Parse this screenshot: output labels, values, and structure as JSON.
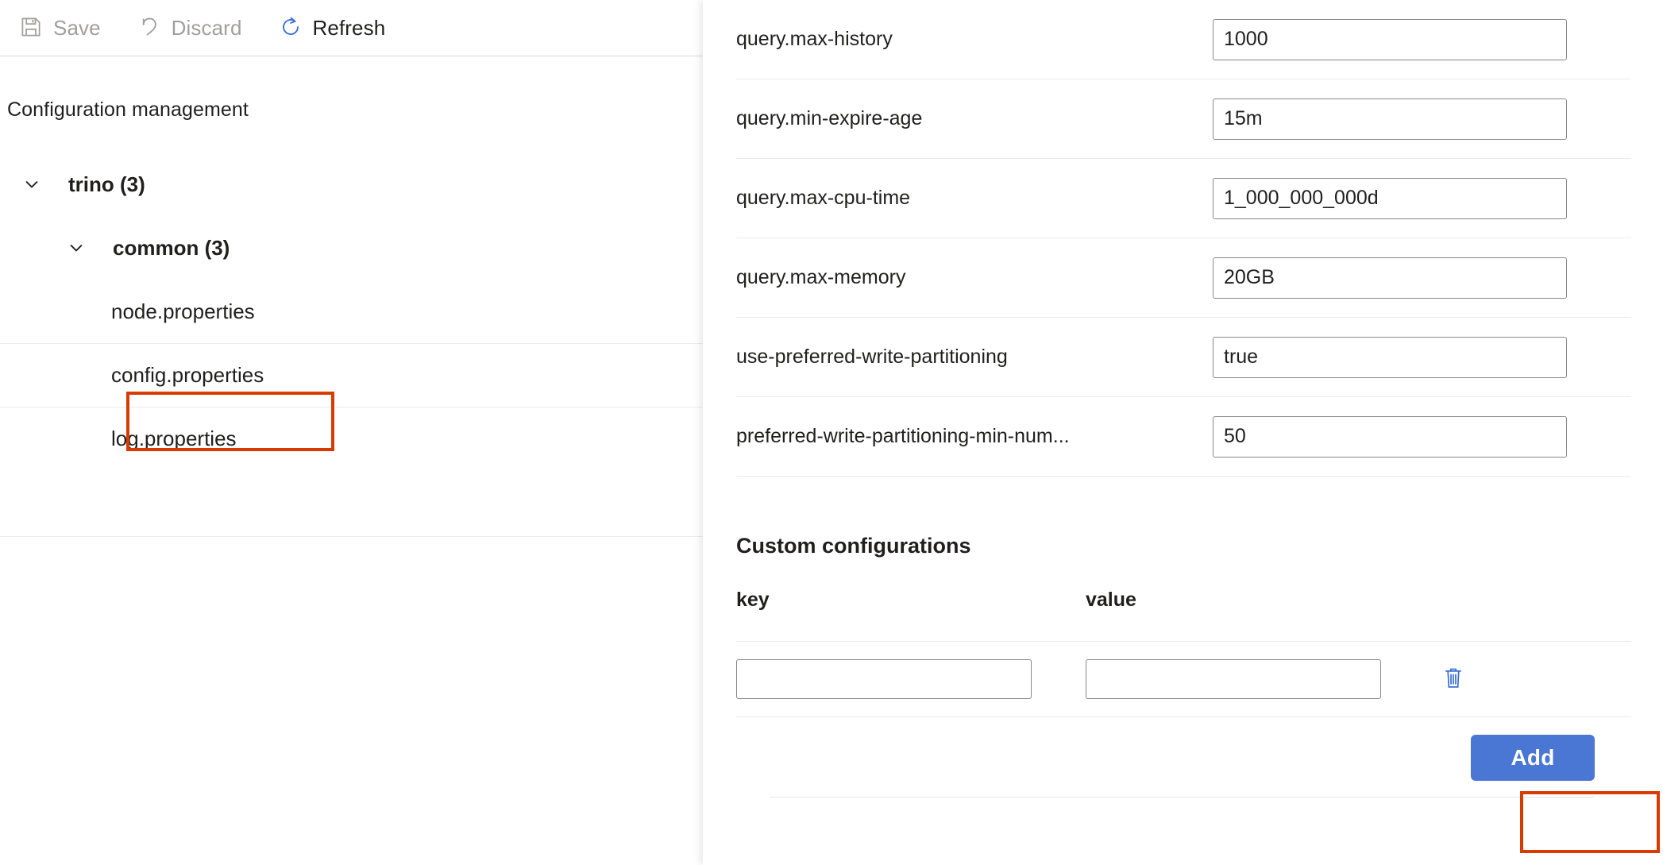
{
  "toolbar": {
    "items": [
      {
        "label": "Save",
        "icon": "save-icon",
        "state": "disabled"
      },
      {
        "label": "Discard",
        "icon": "undo-icon",
        "state": "disabled"
      },
      {
        "label": "Refresh",
        "icon": "refresh-icon",
        "state": "enabled"
      }
    ]
  },
  "left_pane": {
    "title": "Configuration management",
    "tree": [
      {
        "label": "trino (3)",
        "level": 0,
        "expanded": true,
        "bold": true,
        "has_chevron": true,
        "divider_above": false,
        "selected": false
      },
      {
        "label": "common (3)",
        "level": 1,
        "expanded": true,
        "bold": true,
        "has_chevron": true,
        "divider_above": false,
        "selected": false
      },
      {
        "label": "node.properties",
        "level": 2,
        "expanded": false,
        "bold": false,
        "has_chevron": false,
        "divider_above": false,
        "selected": false
      },
      {
        "label": "config.properties",
        "level": 2,
        "expanded": false,
        "bold": false,
        "has_chevron": false,
        "divider_above": true,
        "selected": true
      },
      {
        "label": "log.properties",
        "level": 2,
        "expanded": false,
        "bold": false,
        "has_chevron": false,
        "divider_above": true,
        "selected": false
      }
    ]
  },
  "right_panel": {
    "config_rows": [
      {
        "key": "query.max-history",
        "value": "1000"
      },
      {
        "key": "query.min-expire-age",
        "value": "15m"
      },
      {
        "key": "query.max-cpu-time",
        "value": "1_000_000_000d"
      },
      {
        "key": "query.max-memory",
        "value": "20GB"
      },
      {
        "key": "use-preferred-write-partitioning",
        "value": "true"
      },
      {
        "key": "preferred-write-partitioning-min-num...",
        "value": "50"
      }
    ],
    "custom": {
      "section_title": "Custom configurations",
      "columns": {
        "key": "key",
        "value": "value"
      },
      "rows": [
        {
          "key": "",
          "value": "",
          "key_placeholder": "",
          "value_placeholder": "",
          "delete_icon": "trash-icon"
        }
      ],
      "add_label": "Add"
    }
  },
  "annotations": [
    {
      "name": "config-properties-highlight",
      "color": "#d83b01"
    },
    {
      "name": "add-button-highlight",
      "color": "#d83b01"
    }
  ],
  "colors": {
    "accent_blue": "#4a77d4",
    "icon_blue": "#3b6fd4",
    "annotation_red": "#d83b01",
    "text_primary": "#201f1e",
    "text_disabled": "#a19f9d",
    "divider": "#edebe9"
  }
}
